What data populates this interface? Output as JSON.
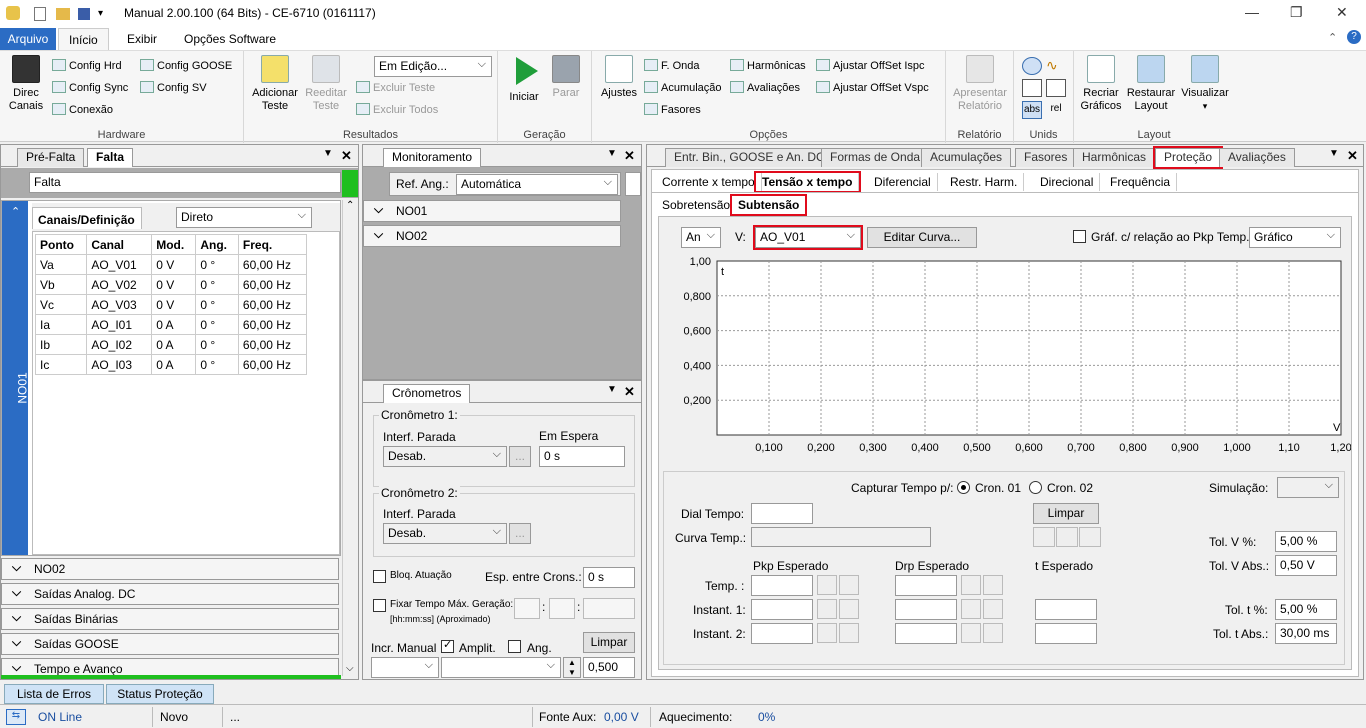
{
  "window": {
    "title": "Manual 2.00.100 (64 Bits) - CE-6710 (0161117)"
  },
  "ribbon_tabs": [
    {
      "label": "Arquivo"
    },
    {
      "label": "Início"
    },
    {
      "label": "Exibir"
    },
    {
      "label": "Opções Software"
    }
  ],
  "ribbon": {
    "hardware": {
      "label": "Hardware",
      "direc": "Direc Canais",
      "config_hrd": "Config Hrd",
      "config_sync": "Config Sync",
      "conexao": "Conexão",
      "config_goose": "Config GOOSE",
      "config_sv": "Config SV"
    },
    "resultados": {
      "label": "Resultados",
      "adicionar": "Adicionar Teste",
      "reeditar": "Reeditar Teste",
      "status_value": "Em Edição...",
      "excluir_teste": "Excluir Teste",
      "excluir_todos": "Excluir Todos"
    },
    "geracao": {
      "label": "Geração",
      "iniciar": "Iniciar",
      "parar": "Parar"
    },
    "opcoes": {
      "label": "Opções",
      "ajustes": "Ajustes",
      "f_onda": "F. Onda",
      "acumulacao": "Acumulação",
      "fasores": "Fasores",
      "harmonicas": "Harmônicas",
      "avaliacoes": "Avaliações",
      "offset_ispc": "Ajustar OffSet Ispc",
      "offset_vspc": "Ajustar OffSet Vspc"
    },
    "relatorio": {
      "label": "Relatório",
      "apresentar": "Apresentar Relatório"
    },
    "unids": {
      "label": "Unids",
      "abs": "abs",
      "rel": "rel"
    },
    "layout": {
      "label": "Layout",
      "recriar": "Recriar Gráficos",
      "restaurar": "Restaurar Layout",
      "visualizar": "Visualizar"
    }
  },
  "left": {
    "tabs": [
      "Pré-Falta",
      "Falta"
    ],
    "field_value": "Falta",
    "side_label": "NO01",
    "canais_tab": "Canais/Definição",
    "mode": "Direto",
    "columns": [
      "Ponto",
      "Canal",
      "Mod.",
      "Ang.",
      "Freq."
    ],
    "rows": [
      [
        "Va",
        "AO_V01",
        "0 V",
        "0 °",
        "60,00 Hz"
      ],
      [
        "Vb",
        "AO_V02",
        "0 V",
        "0 °",
        "60,00 Hz"
      ],
      [
        "Vc",
        "AO_V03",
        "0 V",
        "0 °",
        "60,00 Hz"
      ],
      [
        "Ia",
        "AO_I01",
        "0 A",
        "0 °",
        "60,00 Hz"
      ],
      [
        "Ib",
        "AO_I02",
        "0 A",
        "0 °",
        "60,00 Hz"
      ],
      [
        "Ic",
        "AO_I03",
        "0 A",
        "0 °",
        "60,00 Hz"
      ]
    ],
    "sections": [
      "NO02",
      "Saídas Analog. DC",
      "Saídas Binárias",
      "Saídas GOOSE",
      "Tempo e Avanço"
    ]
  },
  "monitor": {
    "tab": "Monitoramento",
    "ref_label": "Ref. Ang.:",
    "ref_value": "Automática",
    "nodes": [
      "NO01",
      "NO02"
    ]
  },
  "crono": {
    "tab": "Crônometros",
    "c1": "Cronômetro 1:",
    "c2": "Cronômetro 2:",
    "interf": "Interf. Parada",
    "desab": "Desab.",
    "em_espera": "Em Espera",
    "espera_value": "0 s",
    "bloq": "Bloq. Atuação",
    "esp": "Esp. entre Crons.:",
    "esp_value": "0 s",
    "fixar": "Fixar Tempo Máx. Geração:",
    "fixar_sub": "[hh:mm:ss] (Aproximado)",
    "incr": "Incr. Manual",
    "amplit": "Amplit.",
    "ang": "Ang.",
    "limpar": "Limpar",
    "step_value": "0,500"
  },
  "right": {
    "top_tabs": [
      "Entr. Bin., GOOSE e An. DC",
      "Formas de Onda",
      "Acumulações",
      "Fasores",
      "Harmônicas",
      "Proteção",
      "Avaliações"
    ],
    "sub_tabs": [
      "Corrente x tempo",
      "Tensão x tempo",
      "Diferencial",
      "Restr. Harm.",
      "Direcional",
      "Frequência"
    ],
    "sub2_tabs": [
      "Sobretensão",
      "Subtensão"
    ],
    "an_value": "An",
    "v_label": "V:",
    "v_value": "AO_V01",
    "editar": "Editar Curva...",
    "graf_check": "Gráf. c/ relação ao Pkp Temp.",
    "graf_value": "Gráfico",
    "capturar": "Capturar Tempo p/:",
    "cron01": "Cron. 01",
    "cron02": "Cron. 02",
    "simulacao": "Simulação:",
    "dial": "Dial Tempo:",
    "curva": "Curva Temp.:",
    "limpar": "Limpar",
    "pkp": "Pkp Esperado",
    "drp": "Drp Esperado",
    "t_esp": "t Esperado",
    "temp": "Temp. :",
    "inst1": "Instant. 1:",
    "inst2": "Instant. 2:",
    "tol_v_pct": "Tol. V %:",
    "tol_v_pct_value": "5,00 %",
    "tol_v_abs": "Tol. V Abs.:",
    "tol_v_abs_value": "0,50 V",
    "tol_t_pct": "Tol. t %:",
    "tol_t_pct_value": "5,00 %",
    "tol_t_abs": "Tol. t Abs.:",
    "tol_t_abs_value": "30,00 ms"
  },
  "chart_data": {
    "type": "line",
    "xlabel": "V",
    "ylabel": "t",
    "x_ticks": [
      "0,100",
      "0,200",
      "0,300",
      "0,400",
      "0,500",
      "0,600",
      "0,700",
      "0,800",
      "0,900",
      "1,000",
      "1,10",
      "1,20"
    ],
    "y_ticks": [
      "1,00",
      "0,800",
      "0,600",
      "0,400",
      "0,200"
    ],
    "xlim": [
      0,
      1.2
    ],
    "ylim": [
      0,
      1
    ],
    "grid": true,
    "series": []
  },
  "bottom_tabs": [
    "Lista de Erros",
    "Status Proteção"
  ],
  "status": {
    "online": "ON Line",
    "novo": "Novo",
    "dots": "...",
    "fonte_label": "Fonte Aux:",
    "fonte_value": "0,00 V",
    "aquec_label": "Aquecimento:",
    "aquec_value": "0%"
  },
  "colors": {
    "accent": "#2b6cc4",
    "highlight": "#e00b1c",
    "active_green": "#1fbf1f"
  }
}
